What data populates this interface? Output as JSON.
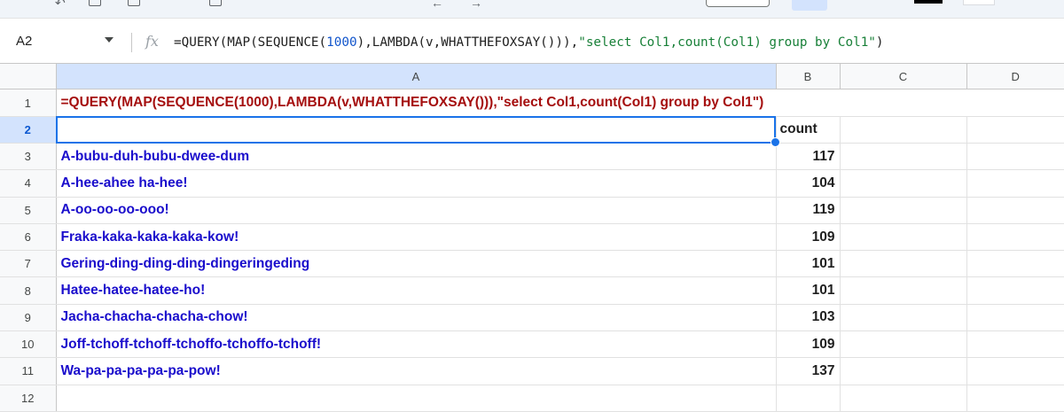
{
  "formula_bar": {
    "name_box": "A2",
    "fx_label": "fx",
    "formula_part1": "=QUERY(MAP(SEQUENCE(",
    "formula_num": "1000",
    "formula_part2": "),LAMBDA(v,WHATTHEFOXSAY())),",
    "formula_str": "\"select Col1,count(Col1) group by Col1\"",
    "formula_part3": ")"
  },
  "columns": [
    "A",
    "B",
    "C",
    "D"
  ],
  "row_numbers": [
    "1",
    "2",
    "3",
    "4",
    "5",
    "6",
    "7",
    "8",
    "9",
    "10",
    "11",
    "12"
  ],
  "cells": {
    "a1": "=QUERY(MAP(SEQUENCE(1000),LAMBDA(v,WHATTHEFOXSAY())),\"select Col1,count(Col1) group by Col1\")",
    "a2": "",
    "b2": "count"
  },
  "results": [
    {
      "sound": "A-bubu-duh-bubu-dwee-dum",
      "count": "117"
    },
    {
      "sound": "A-hee-ahee ha-hee!",
      "count": "104"
    },
    {
      "sound": "A-oo-oo-oo-ooo!",
      "count": "119"
    },
    {
      "sound": "Fraka-kaka-kaka-kaka-kow!",
      "count": "109"
    },
    {
      "sound": "Gering-ding-ding-ding-dingeringeding",
      "count": "101"
    },
    {
      "sound": "Hatee-hatee-hatee-ho!",
      "count": "101"
    },
    {
      "sound": "Jacha-chacha-chacha-chow!",
      "count": "103"
    },
    {
      "sound": "Joff-tchoff-tchoff-tchoffo-tchoffo-tchoff!",
      "count": "109"
    },
    {
      "sound": "Wa-pa-pa-pa-pa-pa-pow!",
      "count": "137"
    }
  ],
  "colors": {
    "active_border": "#1a73e8",
    "header_selected": "#d3e3fd",
    "formula_cell_text": "#a50e0e",
    "result_text": "#1a0dcc"
  }
}
